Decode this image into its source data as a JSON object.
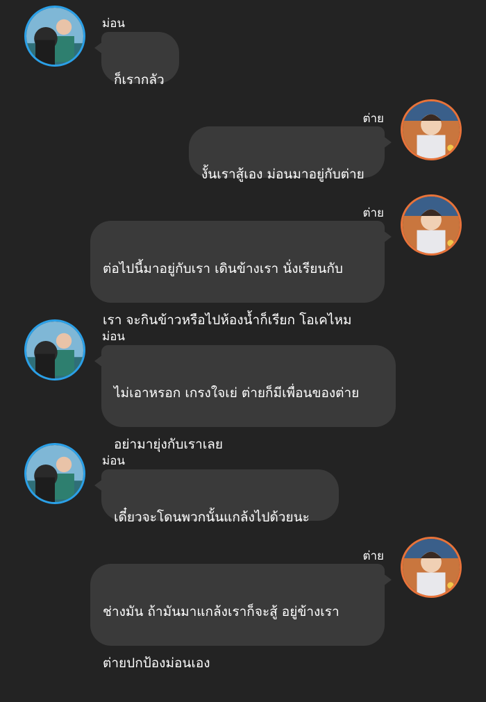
{
  "chat": {
    "messages": [
      {
        "side": "left",
        "sender": "ม่อน",
        "lines": [
          "ก็เรากลัว"
        ]
      },
      {
        "side": "right",
        "sender": "ต่าย",
        "lines": [
          "งั้นเราสู้เอง ม่อนมาอยู่กับต่าย"
        ]
      },
      {
        "side": "right",
        "sender": "ต่าย",
        "lines": [
          "ต่อไปนี้มาอยู่กับเรา เดินข้างเรา นั่งเรียนกับ",
          "เรา จะกินข้าวหรือไปห้องน้ำก็เรียก โอเคไหม"
        ]
      },
      {
        "side": "left",
        "sender": "ม่อน",
        "lines": [
          "ไม่เอาหรอก เกรงใจเย่ ต่ายก็มีเพื่อนของต่าย",
          "อย่ามายุ่งกับเราเลย"
        ]
      },
      {
        "side": "left",
        "sender": "ม่อน",
        "lines": [
          "เดี๋ยวจะโดนพวกนั้นแกล้งไปด้วยนะ"
        ]
      },
      {
        "side": "right",
        "sender": "ต่าย",
        "lines": [
          "ช่างมัน ถ้ามันมาแกล้งเราก็จะสู้  อยู่ข้างเรา",
          "ต่ายปกป้องม่อนเอง"
        ]
      }
    ]
  },
  "theme": {
    "background": "#232323",
    "bubble": "#3a3a3a",
    "left_avatar_ring": "#2aa0e8",
    "right_avatar_ring": "#e8733a"
  },
  "icons": {
    "left_avatar": "avatar-mon-icon",
    "right_avatar": "avatar-tai-icon"
  }
}
